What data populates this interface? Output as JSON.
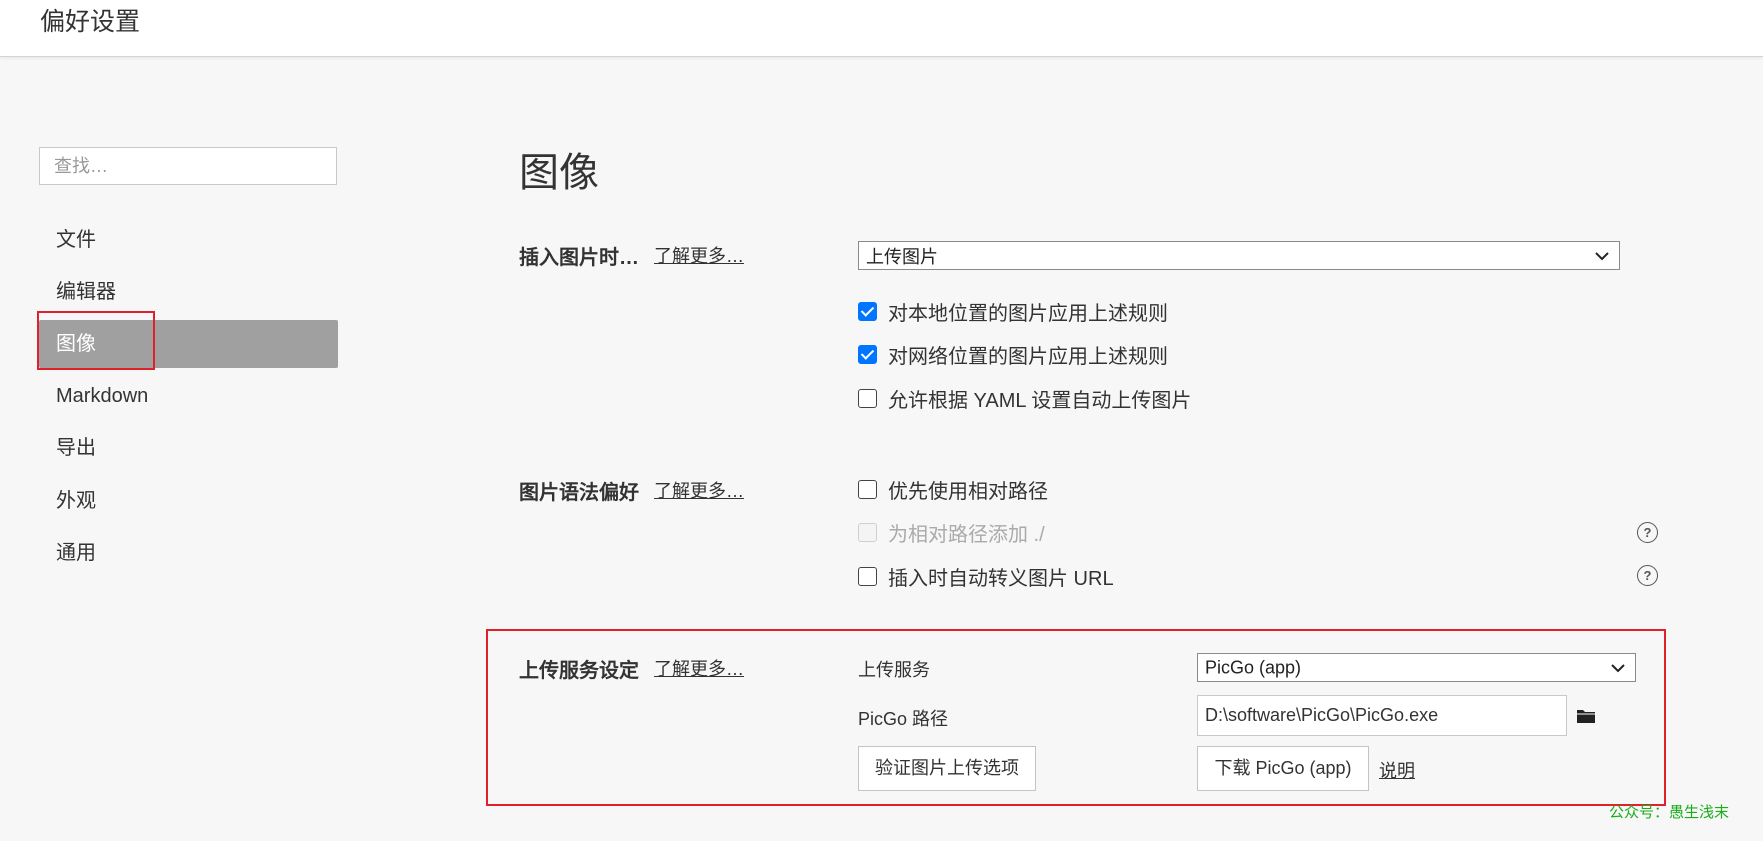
{
  "window": {
    "title": "偏好设置"
  },
  "sidebar": {
    "search_placeholder": "查找…",
    "items": [
      {
        "label": "文件"
      },
      {
        "label": "编辑器"
      },
      {
        "label": "图像"
      },
      {
        "label": "Markdown"
      },
      {
        "label": "导出"
      },
      {
        "label": "外观"
      },
      {
        "label": "通用"
      }
    ],
    "active_index": 2
  },
  "main": {
    "title": "图像",
    "insert_image": {
      "label": "插入图片时…",
      "learn_more": "了解更多…",
      "select_value": "上传图片",
      "options": [
        {
          "label": "对本地位置的图片应用上述规则",
          "checked": true
        },
        {
          "label": "对网络位置的图片应用上述规则",
          "checked": true
        },
        {
          "label": "允许根据 YAML 设置自动上传图片",
          "checked": false
        }
      ]
    },
    "image_syntax": {
      "label": "图片语法偏好",
      "learn_more": "了解更多…",
      "options": [
        {
          "label": "优先使用相对路径",
          "checked": false,
          "disabled": false
        },
        {
          "label": "为相对路径添加 ./",
          "checked": false,
          "disabled": true,
          "help_icon": "question-circle-icon"
        },
        {
          "label": "插入时自动转义图片 URL",
          "checked": false,
          "disabled": false,
          "help_icon": "question-circle-icon"
        }
      ]
    },
    "upload_service": {
      "label": "上传服务设定",
      "learn_more": "了解更多…",
      "service_label": "上传服务",
      "service_value": "PicGo (app)",
      "path_label": "PicGo 路径",
      "path_value": "D:\\software\\PicGo\\PicGo.exe",
      "verify_button": "验证图片上传选项",
      "download_button": "下载 PicGo (app)",
      "help_link": "说明"
    }
  },
  "watermark": "公众号：愚生浅末",
  "colors": {
    "accent": "#0075ff",
    "highlight_box": "#e0202a",
    "active_nav": "#a0a0a0",
    "watermark": "#1aad19"
  }
}
